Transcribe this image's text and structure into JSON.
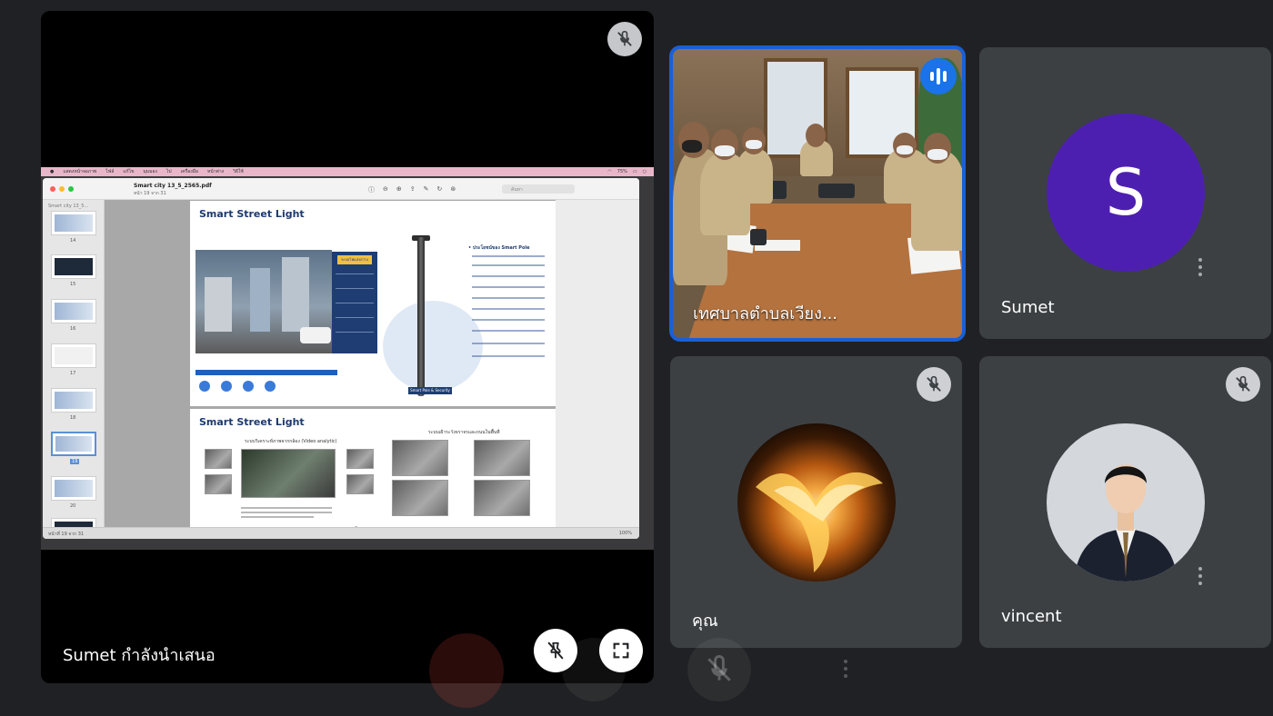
{
  "presenter": {
    "name_label": "Sumet กำลังนำเสนอ",
    "shared_screen": {
      "menubar": [
        "แสดงหน้าจอภาพ",
        "ไฟล์",
        "แก้ไข",
        "มุมมอง",
        "ไป",
        "เครื่องมือ",
        "หน้าต่าง",
        "วิธีใช้"
      ],
      "menubar_right": "75%",
      "doc_title": "Smart city 13_5_2565.pdf",
      "doc_subtitle": "หน้า 19 จาก 31",
      "search_placeholder": "ค้นหา",
      "sidebar_title": "Smart city 13_5...",
      "thumbnail_numbers": [
        "14",
        "15",
        "16",
        "17",
        "18",
        "19",
        "20"
      ],
      "selected_thumbnail": "19",
      "slide1_title": "Smart Street Light",
      "slide1_panel_tag": "ระบบไฟแสงสว่าง",
      "slide1_features_title": "• ประโยชน์ของ Smart Pole",
      "slide1_bottom_label": "Smart Pole & Security",
      "slide2_title": "Smart Street Light",
      "slide2_left_caption": "ระบบวิเคราะห์ภาพจากกล้อง (Video analytic)",
      "slide2_right_caption": "ระบบเฝ้าระวังจราจรและถนนในพื้นที่",
      "slide2_footer": "ระบบ IP camera",
      "status_left": "หน้าที่ 19 จาก 31",
      "status_right": "100%"
    }
  },
  "participants": {
    "video_tile": {
      "name": "เทศบาลตำบลเวียง..."
    },
    "sumet": {
      "name": "Sumet",
      "initial": "S",
      "avatar_color": "#4d1fb1"
    },
    "you": {
      "name": "คุณ"
    },
    "vincent": {
      "name": "vincent"
    }
  },
  "icons": {
    "presenter_mic": "mic-off-icon",
    "unpin": "unpin-icon",
    "fullscreen": "fullscreen-icon",
    "speaking": "audio-level-icon",
    "more": "more-vert-icon"
  },
  "colors": {
    "background": "#202124",
    "tile": "#3c4043",
    "speaking_border": "#1a5fd8",
    "sumet_avatar": "#4d1fb1"
  }
}
